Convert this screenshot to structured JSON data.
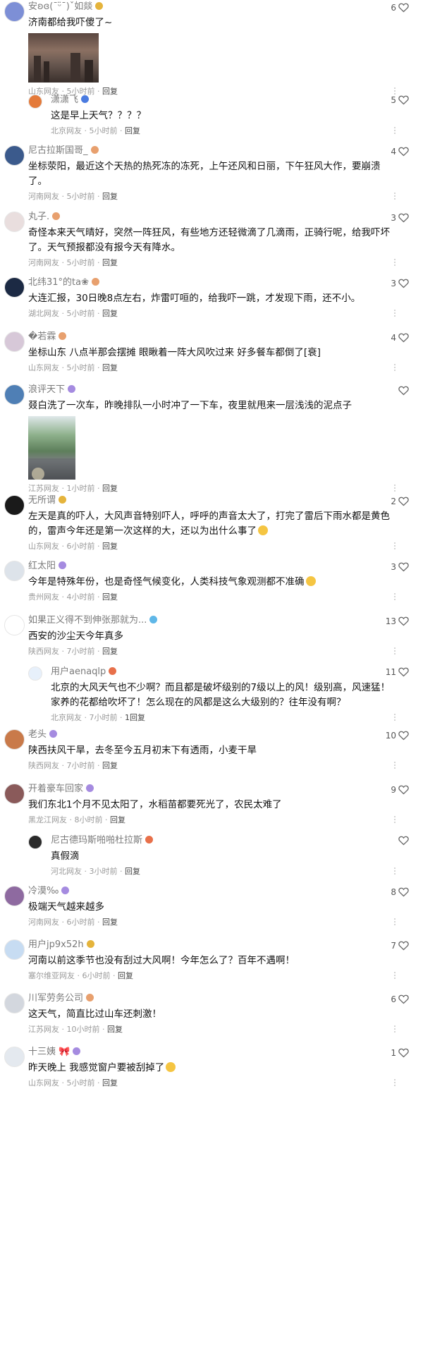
{
  "comments": [
    {
      "user": "安ʚɞ(¯ᵕ̈¯)ˇ如燚",
      "badge_color": "#e5b43c",
      "text": "济南都给我吓傻了~",
      "location": "山东网友",
      "time": "5小时前",
      "reply": "回复",
      "likes": "6",
      "has_image": true,
      "image_desc": "dark-sky-city-photo"
    },
    {
      "user": "潇潇飞",
      "badge_color": "#4a7be0",
      "text": "这是早上天气？？？？",
      "location": "北京网友",
      "time": "5小时前",
      "reply": "回复",
      "likes": "5",
      "is_reply": true
    },
    {
      "user": "尼古拉斯国哥_",
      "badge_color": "#e8a06e",
      "text": "坐标荥阳，最近这个天热的热死冻的冻死，上午还风和日丽，下午狂风大作，要崩溃了。",
      "location": "河南网友",
      "time": "5小时前",
      "reply": "回复",
      "likes": "4"
    },
    {
      "user": "丸子.",
      "badge_color": "#e8a06e",
      "text": "奇怪本来天气晴好，突然一阵狂风，有些地方还轻微滴了几滴雨，正骑行呢，给我吓坏了。天气预报都没有报今天有降水。",
      "location": "河南网友",
      "time": "5小时前",
      "reply": "回复",
      "likes": "3"
    },
    {
      "user": "北纬31°的ta❀",
      "badge_color": "#e8a06e",
      "text": "大连汇报，30日晚8点左右，炸雷叮咺的，给我吓一跳，才发现下雨，还不小。",
      "location": "湖北网友",
      "time": "5小时前",
      "reply": "回复",
      "likes": "3"
    },
    {
      "user": "�若霖",
      "badge_color": "#e8a06e",
      "text": "坐标山东 八点半那会摆摊 眼瞅着一阵大风吹过来 好多餐车都倒了[衰]",
      "location": "山东网友",
      "time": "5小时前",
      "reply": "回复",
      "likes": "4"
    },
    {
      "user": "浪评天下",
      "badge_color": "#a58be0",
      "text": "叕白洗了一次车，昨晚排队一小时冲了一下车，夜里就甩来一层浅浅的泥点子",
      "location": "江苏网友",
      "time": "1小时前",
      "reply": "回复",
      "likes": "",
      "has_image": true,
      "image_desc": "dirty-car-windshield-photo"
    },
    {
      "user": "无所谓",
      "badge_color": "#e5b43c",
      "text": "左天是真的吓人，大风声音特别吓人，呼呼的声音太大了，打完了雷后下雨水都是黄色的，雷声今年还是第一次这样的大，还以为出什么事了",
      "location": "山东网友",
      "time": "6小时前",
      "reply": "回复",
      "likes": "2",
      "emoji": true
    },
    {
      "user": "红太阳",
      "badge_color": "#a58be0",
      "text": "今年是特殊年份，也是奇怪气候变化，人类科技气象观测都不准确",
      "location": "贵州网友",
      "time": "4小时前",
      "reply": "回复",
      "likes": "3",
      "emoji": true
    },
    {
      "user": "如果正义得不到伸张那就为...",
      "badge_color": "#5fb7e8",
      "text": "西安的沙尘天今年真多",
      "location": "陕西网友",
      "time": "7小时前",
      "reply": "回复",
      "likes": "13"
    },
    {
      "user": "用户aenaqlp",
      "badge_color": "#e8704a",
      "text": "北京的大风天气也不少啊？而且都是破坏级别的7级以上的风！级别高，风速猛！家养的花都给吹坏了！怎么现在的风都是这么大级别的？往年没有啊？",
      "location": "北京网友",
      "time": "7小时前",
      "reply": "1回复",
      "likes": "11",
      "is_reply": true
    },
    {
      "user": "老头",
      "badge_color": "#a58be0",
      "text": "陕西扶风干旱，去冬至今五月初末下有透雨，小麦干旱",
      "location": "陕西网友",
      "time": "7小时前",
      "reply": "回复",
      "likes": "10"
    },
    {
      "user": "开着豪车回家",
      "badge_color": "#a58be0",
      "text": "我们东北1个月不见太阳了，水稻苗都要死光了，农民太难了",
      "location": "黑龙江网友",
      "time": "8小时前",
      "reply": "回复",
      "likes": "9"
    },
    {
      "user": "尼古德玛斯啪啪杜拉斯",
      "badge_color": "#e8704a",
      "text": "真假滴",
      "location": "河北网友",
      "time": "3小时前",
      "reply": "回复",
      "likes": "",
      "is_reply": true
    },
    {
      "user": "冷漠‰",
      "badge_color": "#a58be0",
      "text": "极端天气越来越多",
      "location": "河南网友",
      "time": "6小时前",
      "reply": "回复",
      "likes": "8"
    },
    {
      "user": "用户jp9x52h",
      "badge_color": "#e5b43c",
      "text": "河南以前这季节也没有刮过大风啊！今年怎么了？百年不遇啊！",
      "location": "塞尔维亚网友",
      "time": "6小时前",
      "reply": "回复",
      "likes": "7"
    },
    {
      "user": "川军劳务公司",
      "badge_color": "#e8a06e",
      "text": "这天气，简直比过山车还刺激！",
      "location": "江苏网友",
      "time": "10小时前",
      "reply": "回复",
      "likes": "6"
    },
    {
      "user": "十三姨 🎀",
      "badge_color": "#a58be0",
      "text": "昨天晚上 我感觉窗户要被刮掉了",
      "location": "山东网友",
      "time": "5小时前",
      "reply": "回复",
      "likes": "1",
      "emoji": true
    }
  ],
  "colors": {
    "text": "#111111",
    "meta": "#9a9a9a",
    "name": "#7a7a7a",
    "divider": "#eeeeee"
  }
}
